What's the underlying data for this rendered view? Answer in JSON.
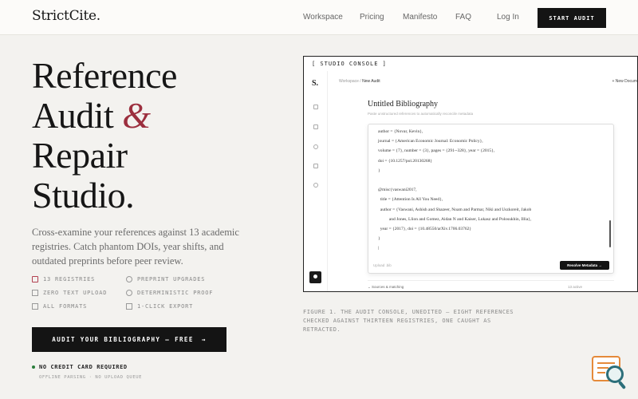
{
  "nav": {
    "logo": "StrictCite.",
    "links": [
      "Workspace",
      "Pricing",
      "Manifesto",
      "FAQ"
    ],
    "login": "Log In",
    "cta": "START AUDIT"
  },
  "hero": {
    "headline_1": "Reference",
    "headline_2a": "Audit ",
    "headline_amp": "&",
    "headline_3": "Repair",
    "headline_4": "Studio.",
    "subtitle": "Cross-examine your references against 13 academic registries. Catch phantom DOIs, year shifts, and outdated preprints before peer review.",
    "features": [
      "13 REGISTRIES",
      "PREPRINT UPGRADES",
      "ZERO TEXT UPLOAD",
      "DETERMINISTIC PROOF",
      "ALL FORMATS",
      "1-CLICK EXPORT"
    ],
    "cta": "AUDIT YOUR BIBLIOGRAPHY — FREE",
    "cta_arrow": "→",
    "note_1": "NO CREDIT CARD REQUIRED",
    "note_2": "OFFLINE PARSING · NO UPLOAD QUEUE"
  },
  "console": {
    "tab": "[ STUDIO CONSOLE ]",
    "side_logo": "S.",
    "crumb_root": "Workspace",
    "crumb_sep": " / ",
    "crumb_current": "New Audit",
    "new_doc": "+ New Docum",
    "doc_title": "Untitled Bibliography",
    "doc_subtitle": "Paste unstructured references to automatically reconcile metadata",
    "code_lines": [
      "author = {Novar, Kevin},",
      "journal = {American Economic Journal: Economic Policy},",
      "volume = {7}, number = {3}, pages = {291--328}, year = {2015},",
      "doi = {10.1257/pol.20130268}",
      "}",
      "",
      "@misc{vaswani2017,",
      "  title = {Attention Is All You Need},",
      "  author = {Vaswani, Ashish and Shazeer, Noam and Parmar, Niki and Uszkoreit, Jakob",
      "          and Jones, Llion and Gomez, Aidan N and Kaiser, Lukasz and Polosukhin, Illia},",
      "  year = {2017}, doi = {10.48550/arXiv.1706.03762}",
      "}",
      "|"
    ],
    "footer_left": "Upload .bib",
    "footer_button": "Resolve Metadata →",
    "sources_label": "⌄ Sources & matching",
    "sources_right": "13 active"
  },
  "caption": "FIGURE 1. THE AUDIT CONSOLE, UNEDITED — EIGHT REFERENCES CHECKED AGAINST THIRTEEN REGISTRIES, ONE CAUGHT AS RETRACTED.",
  "colors": {
    "accent": "#9c2f3e",
    "dark": "#141414",
    "background": "#f3f2ef"
  }
}
